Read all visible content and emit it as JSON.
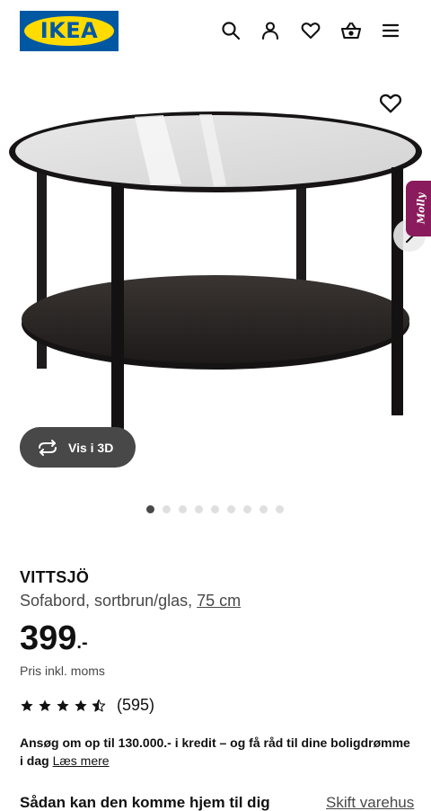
{
  "header": {
    "logo_text": "IKEA",
    "brand_colors": {
      "blue": "#0058a3",
      "yellow": "#ffdb00"
    },
    "icons": [
      "search-icon",
      "account-icon",
      "heart-icon",
      "basket-icon",
      "menu-icon"
    ]
  },
  "gallery": {
    "view_3d_label": "Vis i 3D",
    "chat_badge_label": "Molly",
    "slide_count": 9,
    "active_slide": 1
  },
  "product": {
    "name": "VITTSJÖ",
    "description": "Sofabord, sortbrun/glas, ",
    "size": "75 cm",
    "price_main": "399",
    "price_suffix": ".-",
    "vat_note": "Pris inkl. moms",
    "rating_stars": 4.5,
    "rating_max": 5,
    "rating_count": "(595)"
  },
  "credit": {
    "text": "Ansøg om op til 130.000.- i kredit – og få råd til dine boligdrømme i dag ",
    "link": "Læs mere"
  },
  "delivery": {
    "title": "Sådan kan den komme hjem til dig",
    "change_store_link": "Skift varehus"
  }
}
